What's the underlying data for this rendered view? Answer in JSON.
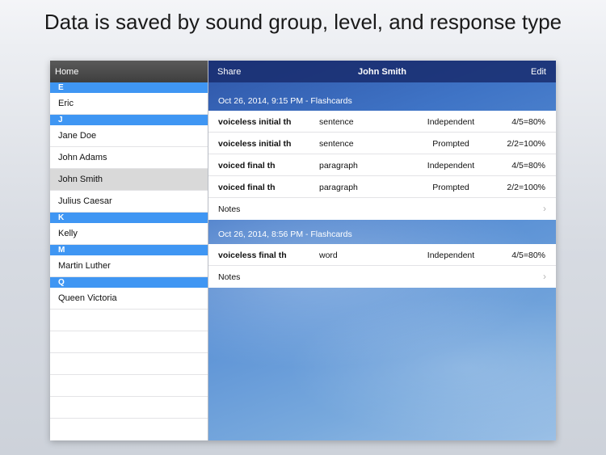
{
  "headline": "Data is saved by sound group, level, and response type",
  "master": {
    "nav_title": "Home",
    "sections": [
      {
        "letter": "E",
        "items": [
          "Eric"
        ]
      },
      {
        "letter": "J",
        "items": [
          "Jane Doe",
          "John Adams",
          "John Smith",
          "Julius Caesar"
        ]
      },
      {
        "letter": "K",
        "items": [
          "Kelly"
        ]
      },
      {
        "letter": "M",
        "items": [
          "Martin Luther"
        ]
      },
      {
        "letter": "Q",
        "items": [
          "Queen Victoria"
        ]
      }
    ],
    "selected": "John Smith"
  },
  "detail": {
    "share_label": "Share",
    "title": "John Smith",
    "edit_label": "Edit",
    "notes_label": "Notes",
    "sessions": [
      {
        "header": "Oct 26, 2014, 9:15 PM - Flashcards",
        "rows": [
          {
            "sound": "voiceless initial th",
            "level": "sentence",
            "response": "Independent",
            "score": "4/5=80%"
          },
          {
            "sound": "voiceless initial th",
            "level": "sentence",
            "response": "Prompted",
            "score": "2/2=100%"
          },
          {
            "sound": "voiced final th",
            "level": "paragraph",
            "response": "Independent",
            "score": "4/5=80%"
          },
          {
            "sound": "voiced final th",
            "level": "paragraph",
            "response": "Prompted",
            "score": "2/2=100%"
          }
        ]
      },
      {
        "header": "Oct 26, 2014, 8:56 PM - Flashcards",
        "rows": [
          {
            "sound": "voiceless final th",
            "level": "word",
            "response": "Independent",
            "score": "4/5=80%"
          }
        ]
      }
    ]
  }
}
